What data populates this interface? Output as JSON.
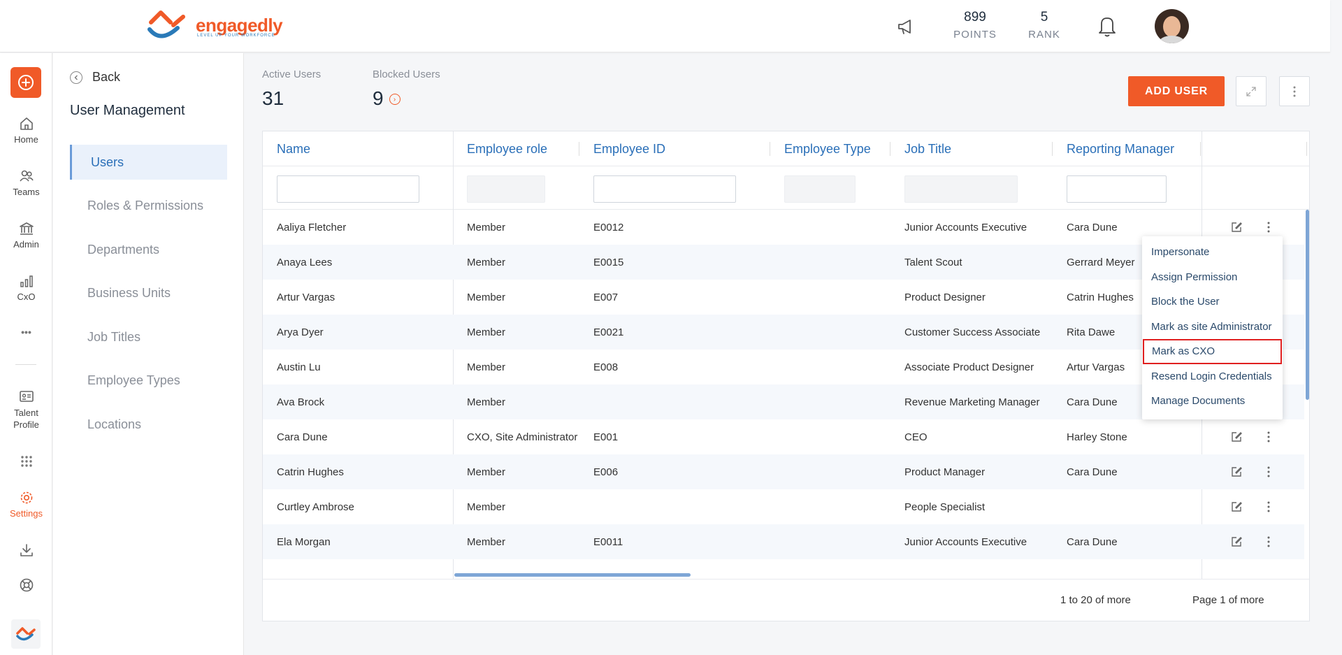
{
  "brand": {
    "name": "engagedly",
    "tagline": "LEVEL UP YOUR WORKFORCE",
    "accent": "#f05a28",
    "link_color": "#2a6fb8"
  },
  "header": {
    "points_value": "899",
    "points_label": "POINTS",
    "rank_value": "5",
    "rank_label": "RANK"
  },
  "rail": {
    "items": [
      {
        "label": "Home",
        "icon": "home-icon"
      },
      {
        "label": "Teams",
        "icon": "teams-icon"
      },
      {
        "label": "Admin",
        "icon": "admin-icon"
      },
      {
        "label": "CxO",
        "icon": "chart-icon"
      },
      {
        "label": "•••",
        "icon": "more-icon"
      },
      {
        "label": "Talent Profile",
        "icon": "id-card-icon"
      },
      {
        "label": "",
        "icon": "grid-icon"
      },
      {
        "label": "Settings",
        "icon": "gear-icon"
      },
      {
        "label": "",
        "icon": "download-icon"
      },
      {
        "label": "",
        "icon": "lifebuoy-icon"
      }
    ]
  },
  "sidebar": {
    "back_label": "Back",
    "title": "User Management",
    "items": [
      {
        "label": "Users",
        "active": true
      },
      {
        "label": "Roles & Permissions"
      },
      {
        "label": "Departments"
      },
      {
        "label": "Business Units"
      },
      {
        "label": "Job Titles"
      },
      {
        "label": "Employee Types"
      },
      {
        "label": "Locations"
      }
    ]
  },
  "stats": {
    "active_label": "Active Users",
    "active_value": "31",
    "blocked_label": "Blocked Users",
    "blocked_value": "9"
  },
  "toolbar": {
    "add_user_label": "ADD USER"
  },
  "table": {
    "columns": [
      "Name",
      "Employee role",
      "Employee ID",
      "Employee Type",
      "Job Title",
      "Reporting Manager"
    ],
    "rows": [
      {
        "name": "Aaliya Fletcher",
        "role": "Member",
        "id": "E0012",
        "type": "",
        "title": "Junior Accounts Executive",
        "manager": "Cara Dune"
      },
      {
        "name": "Anaya Lees",
        "role": "Member",
        "id": "E0015",
        "type": "",
        "title": "Talent Scout",
        "manager": "Gerrard Meyer"
      },
      {
        "name": "Artur Vargas",
        "role": "Member",
        "id": "E007",
        "type": "",
        "title": "Product Designer",
        "manager": "Catrin Hughes"
      },
      {
        "name": "Arya Dyer",
        "role": "Member",
        "id": "E0021",
        "type": "",
        "title": "Customer Success Associate",
        "manager": "Rita Dawe"
      },
      {
        "name": "Austin Lu",
        "role": "Member",
        "id": "E008",
        "type": "",
        "title": "Associate Product Designer",
        "manager": "Artur Vargas"
      },
      {
        "name": "Ava Brock",
        "role": "Member",
        "id": "",
        "type": "",
        "title": "Revenue Marketing Manager",
        "manager": "Cara Dune"
      },
      {
        "name": "Cara Dune",
        "role": "CXO, Site Administrator",
        "id": "E001",
        "type": "",
        "title": "CEO",
        "manager": "Harley Stone"
      },
      {
        "name": "Catrin Hughes",
        "role": "Member",
        "id": "E006",
        "type": "",
        "title": "Product Manager",
        "manager": "Cara Dune"
      },
      {
        "name": "Curtley Ambrose",
        "role": "Member",
        "id": "",
        "type": "",
        "title": "People Specialist",
        "manager": ""
      },
      {
        "name": "Ela Morgan",
        "role": "Member",
        "id": "E0011",
        "type": "",
        "title": "Junior Accounts Executive",
        "manager": "Cara Dune"
      }
    ],
    "footer_range": "1 to 20 of more",
    "footer_page": "Page 1 of more"
  },
  "context_menu": {
    "items": [
      "Impersonate",
      "Assign Permission",
      "Block the User",
      "Mark as site Administrator",
      "Mark as CXO",
      "Resend Login Credentials",
      "Manage Documents"
    ],
    "highlighted_index": 4,
    "highlight_color": "#e02020"
  }
}
